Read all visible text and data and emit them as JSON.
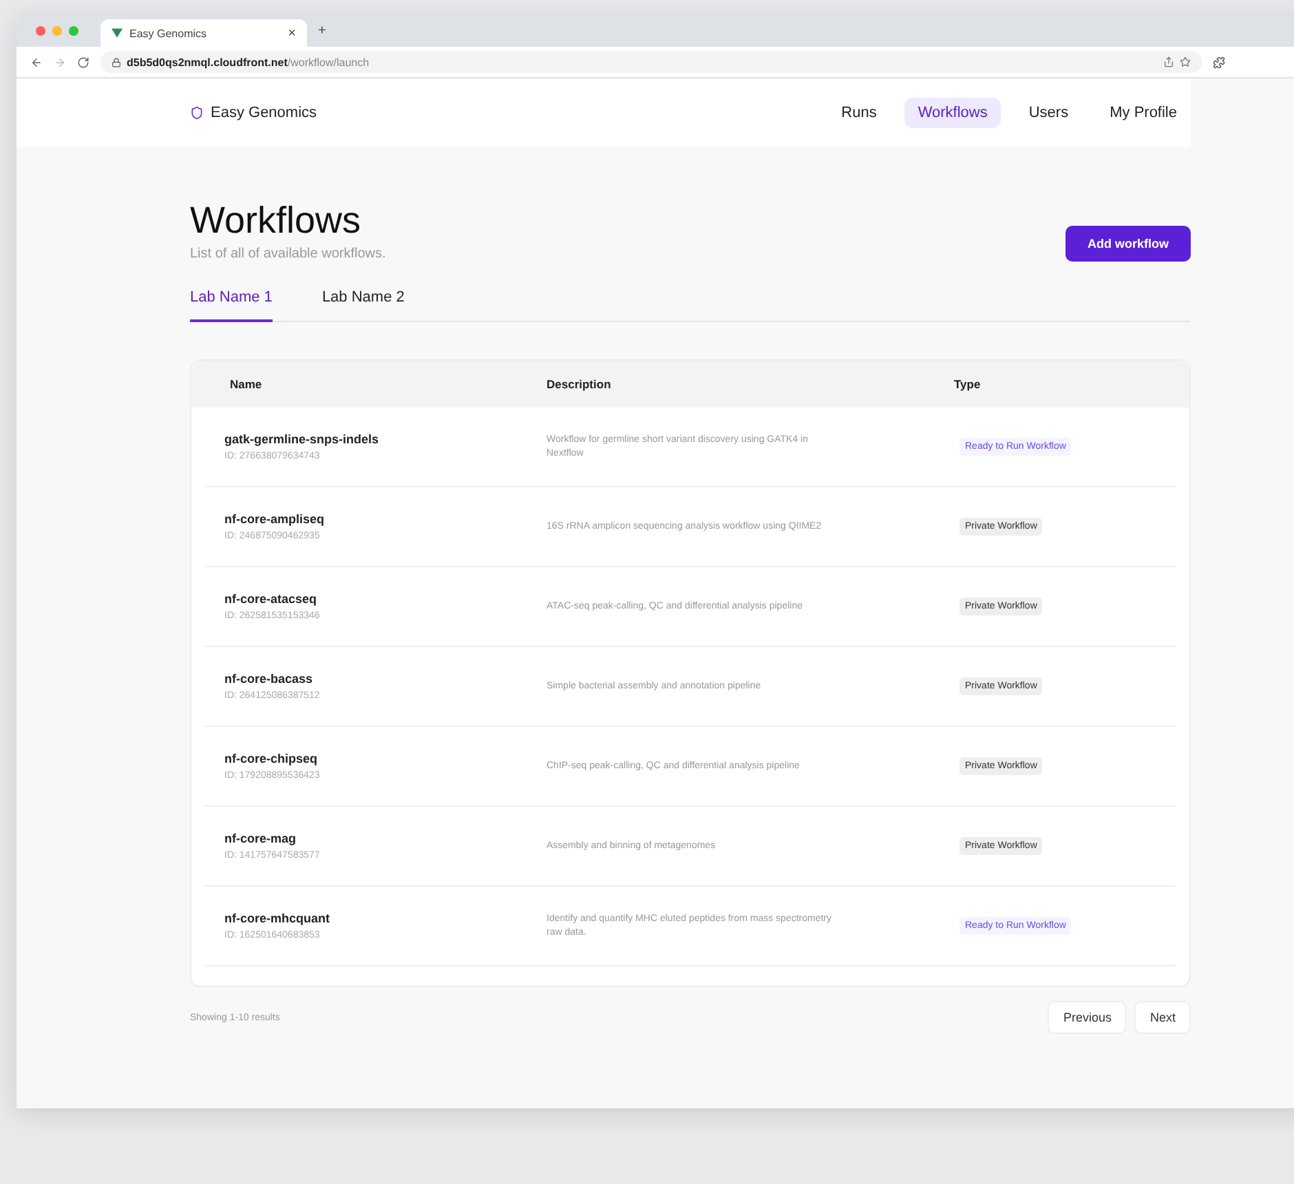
{
  "browser": {
    "tab_title": "Easy Genomics",
    "tab_close": "×",
    "new_tab": "+",
    "url_host": "d5b5d0qs2nmql.cloudfront.net",
    "url_path": "/workflow/launch"
  },
  "nav": {
    "logo": "Easy Genomics",
    "items": [
      {
        "label": "Runs",
        "selected": false
      },
      {
        "label": "Workflows",
        "selected": true
      },
      {
        "label": "Users",
        "selected": false
      },
      {
        "label": "My Profile",
        "selected": false
      }
    ]
  },
  "page": {
    "title": "Workflows",
    "subtitle": "List of all of available workflows.",
    "add_button": "Add workflow"
  },
  "tabs": [
    {
      "label": "Lab Name 1",
      "selected": true
    },
    {
      "label": "Lab Name 2",
      "selected": false
    }
  ],
  "table": {
    "columns": [
      "Name",
      "Description",
      "Type"
    ],
    "rows": [
      {
        "name": "gatk-germline-snps-indels",
        "id": "ID: 276638079634743",
        "description": "Workflow for germline short variant discovery using GATK4 in Nextflow",
        "type": "Ready to Run Workflow",
        "kind": "ready"
      },
      {
        "name": "nf-core-ampliseq",
        "id": "ID: 246875090462935",
        "description": "16S rRNA amplicon sequencing analysis workflow using QIIME2",
        "type": "Private Workflow",
        "kind": "private"
      },
      {
        "name": "nf-core-atacseq",
        "id": "ID: 262581535153346",
        "description": "ATAC-seq peak-calling, QC and differential analysis pipeline",
        "type": "Private Workflow",
        "kind": "private"
      },
      {
        "name": "nf-core-bacass",
        "id": "ID: 264125086387512",
        "description": "Simple bacterial assembly and annotation pipeline",
        "type": "Private Workflow",
        "kind": "private"
      },
      {
        "name": "nf-core-chipseq",
        "id": "ID: 179208895536423",
        "description": "ChIP-seq peak-calling, QC and differential analysis pipeline",
        "type": "Private Workflow",
        "kind": "private"
      },
      {
        "name": "nf-core-mag",
        "id": "ID: 141757647583577",
        "description": "Assembly and binning of metagenomes",
        "type": "Private Workflow",
        "kind": "private"
      },
      {
        "name": "nf-core-mhcquant",
        "id": "ID: 162501640683853",
        "description": "Identify and quantify MHC eluted peptides from mass spectrometry raw data.",
        "type": "Ready to Run Workflow",
        "kind": "ready"
      }
    ]
  },
  "footer": {
    "summary": "Showing 1-10 results",
    "previous": "Previous",
    "next": "Next"
  }
}
